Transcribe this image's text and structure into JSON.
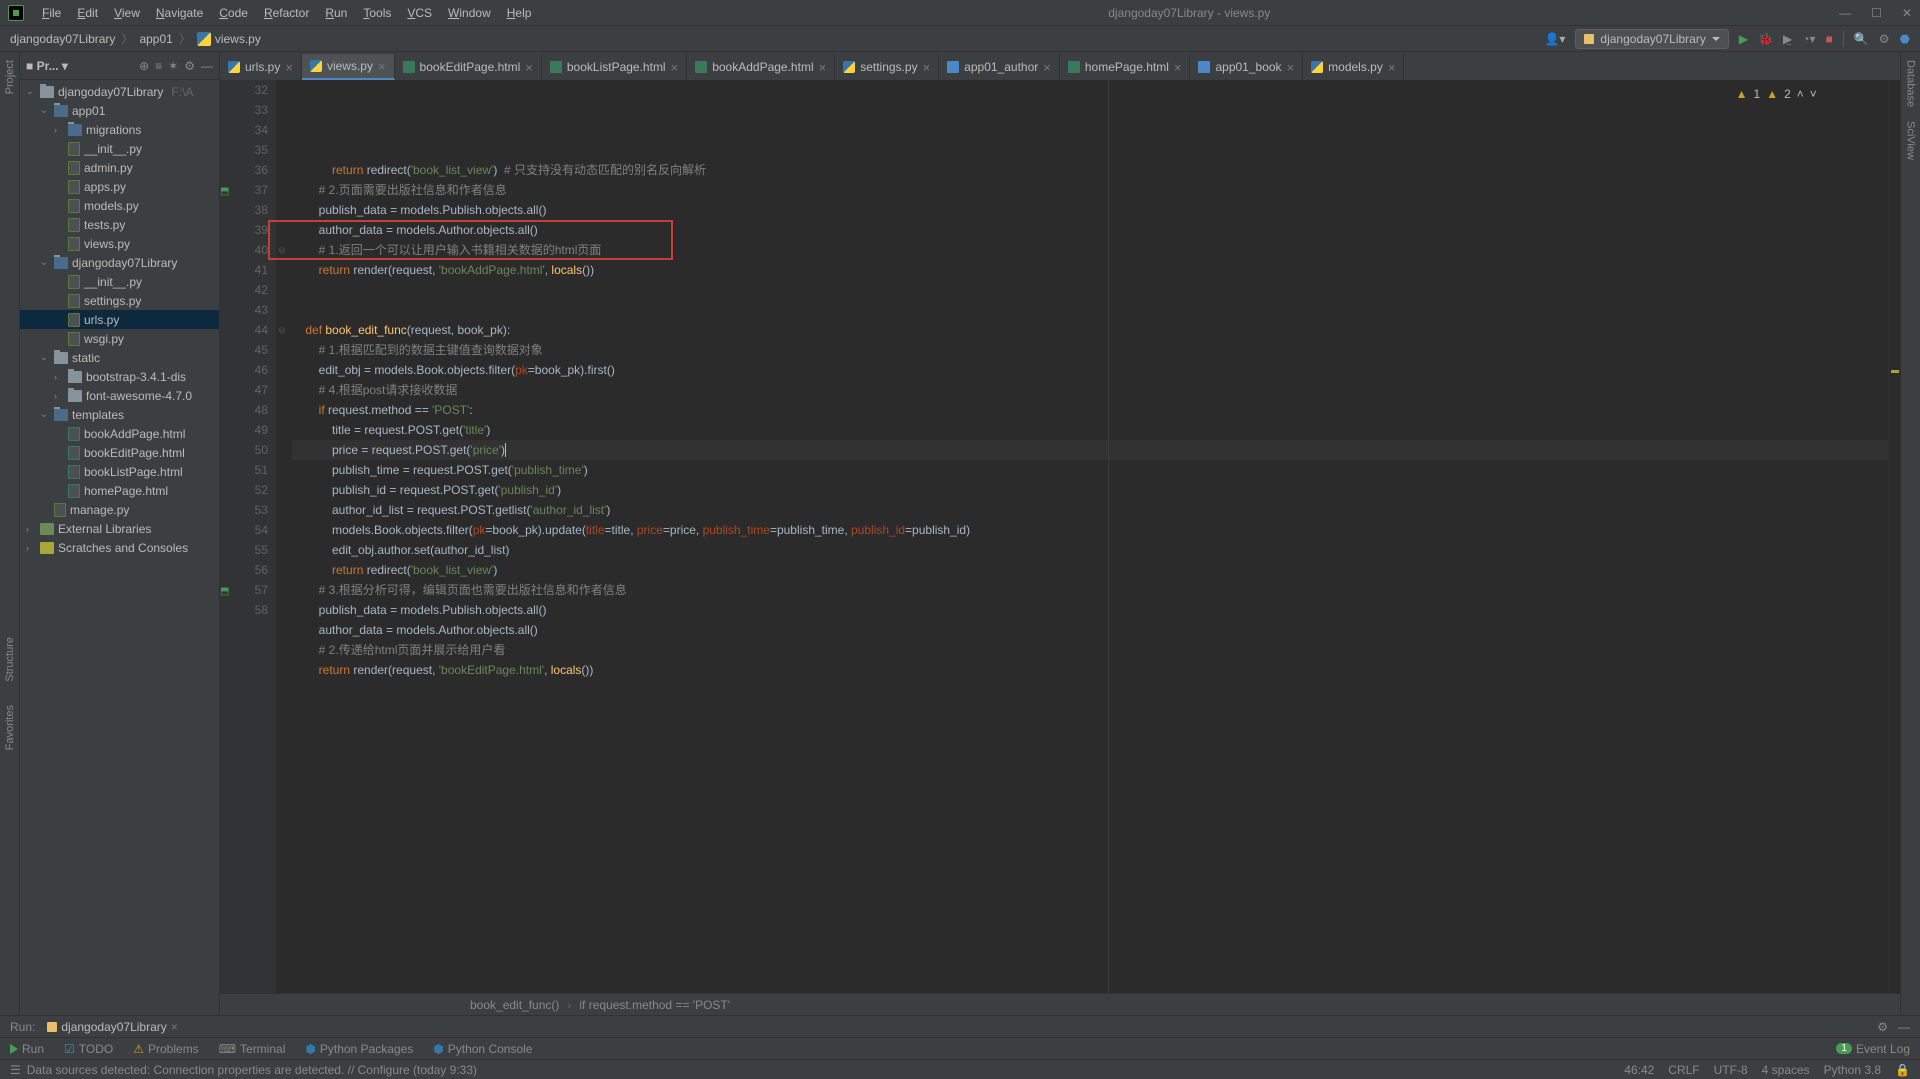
{
  "window_title": "djangoday07Library - views.py",
  "menus": [
    "File",
    "Edit",
    "View",
    "Navigate",
    "Code",
    "Refactor",
    "Run",
    "Tools",
    "VCS",
    "Window",
    "Help"
  ],
  "breadcrumb": [
    "djangoday07Library",
    "app01",
    "views.py"
  ],
  "run_config": "djangoday07Library",
  "warnings": {
    "w": "1",
    "e": "2"
  },
  "project_tree": {
    "root": "djangoday07Library",
    "root_hint": "F:\\A",
    "app01": "app01",
    "migrations": "migrations",
    "files_app01": [
      "__init__.py",
      "admin.py",
      "apps.py",
      "models.py",
      "tests.py",
      "views.py"
    ],
    "inner_pkg": "djangoday07Library",
    "files_inner": [
      "__init__.py",
      "settings.py",
      "urls.py",
      "wsgi.py"
    ],
    "static": "static",
    "static_dirs": [
      "bootstrap-3.4.1-dis",
      "font-awesome-4.7.0"
    ],
    "templates": "templates",
    "template_files": [
      "bookAddPage.html",
      "bookEditPage.html",
      "bookListPage.html",
      "homePage.html"
    ],
    "manage": "manage.py",
    "ext_lib": "External Libraries",
    "scratches": "Scratches and Consoles"
  },
  "tabs": [
    {
      "name": "urls.py",
      "icon": "py"
    },
    {
      "name": "views.py",
      "icon": "py",
      "active": true
    },
    {
      "name": "bookEditPage.html",
      "icon": "html"
    },
    {
      "name": "bookListPage.html",
      "icon": "html"
    },
    {
      "name": "bookAddPage.html",
      "icon": "html"
    },
    {
      "name": "settings.py",
      "icon": "py"
    },
    {
      "name": "app01_author",
      "icon": "table"
    },
    {
      "name": "homePage.html",
      "icon": "html"
    },
    {
      "name": "app01_book",
      "icon": "table"
    },
    {
      "name": "models.py",
      "icon": "py"
    }
  ],
  "code_lines": [
    {
      "n": 32,
      "html": "            <span class='kw'>return</span> redirect(<span class='str'>'book_list_view'</span>)  <span class='cmt'># 只支持没有动态匹配的别名反向解析</span>"
    },
    {
      "n": 33,
      "html": "        <span class='cmt'># 2.页面需要出版社信息和作者信息</span>"
    },
    {
      "n": 34,
      "html": "        publish_data = models.Publish.objects.all()"
    },
    {
      "n": 35,
      "html": "        author_data = models.Author.objects.all()"
    },
    {
      "n": 36,
      "html": "        <span class='cmt'># 1.返回一个可以让用户输入书籍相关数据的html页面</span>"
    },
    {
      "n": 37,
      "html": "        <span class='kw'>return</span> render(request, <span class='str'>'bookAddPage.html'</span>, <span class='fn'>locals</span>())"
    },
    {
      "n": 38,
      "html": ""
    },
    {
      "n": 39,
      "html": ""
    },
    {
      "n": 40,
      "html": "    <span class='kw'>def</span> <span class='fn'>book_edit_func</span>(request, book_pk):"
    },
    {
      "n": 41,
      "html": "        <span class='cmt'># 1.根据匹配到的数据主键值查询数据对象</span>"
    },
    {
      "n": 42,
      "html": "        edit_obj = models.Book.objects.filter(<span class='kwarg'>pk</span>=book_pk).first()"
    },
    {
      "n": 43,
      "html": "        <span class='cmt'># 4.根据post请求接收数据</span>"
    },
    {
      "n": 44,
      "html": "        <span class='kw'>if</span> request.method == <span class='str'>'POST'</span>:"
    },
    {
      "n": 45,
      "html": "            title = request.POST.get(<span class='str'>'title'</span>)"
    },
    {
      "n": 46,
      "html": "            price = request.POST.get(<span class='str'>'price'</span>)<span class='cursor'></span>",
      "caret": true
    },
    {
      "n": 47,
      "html": "            publish_time = request.POST.get(<span class='str'>'publish_time'</span>)"
    },
    {
      "n": 48,
      "html": "            publish_id = request.POST.get(<span class='str'>'publish_id'</span>)"
    },
    {
      "n": 49,
      "html": "            author_id_list = request.POST.getlist(<span class='str'>'author_id_list'</span>)"
    },
    {
      "n": 50,
      "html": "            models.Book.objects.filter(<span class='kwarg'>pk</span>=book_pk).update(<span class='kwarg'>title</span>=title, <span class='kwarg'>price</span>=price, <span class='kwarg'>publish_time</span>=publish_time, <span class='kwarg'>publish_id</span>=publish_id)"
    },
    {
      "n": 51,
      "html": "            edit_obj.author.set(author_id_list)"
    },
    {
      "n": 52,
      "html": "            <span class='kw'>return</span> redirect(<span class='str'>'book_list_view'</span>)"
    },
    {
      "n": 53,
      "html": "        <span class='cmt'># 3.根据分析可得，编辑页面也需要出版社信息和作者信息</span>"
    },
    {
      "n": 54,
      "html": "        publish_data = models.Publish.objects.all()"
    },
    {
      "n": 55,
      "html": "        author_data = models.Author.objects.all()"
    },
    {
      "n": 56,
      "html": "        <span class='cmt'># 2.传递给html页面并展示给用户看</span>"
    },
    {
      "n": 57,
      "html": "        <span class='kw'>return</span> render(request, <span class='str'>'bookEditPage.html'</span>, <span class='fn'>locals</span>())"
    },
    {
      "n": 58,
      "html": ""
    }
  ],
  "nav_crumbs": [
    "book_edit_func()",
    "if request.method == 'POST'"
  ],
  "run_panel_label": "Run:",
  "run_panel_config": "djangoday07Library",
  "tool_tabs": [
    "Run",
    "TODO",
    "Problems",
    "Terminal",
    "Python Packages",
    "Python Console"
  ],
  "event_log": "Event Log",
  "status_msg": "Data sources detected: Connection properties are detected. // Configure (today 9:33)",
  "status_right": {
    "pos": "46:42",
    "sep": "CRLF",
    "enc": "UTF-8",
    "indent": "4 spaces",
    "py": "Python 3.8"
  }
}
